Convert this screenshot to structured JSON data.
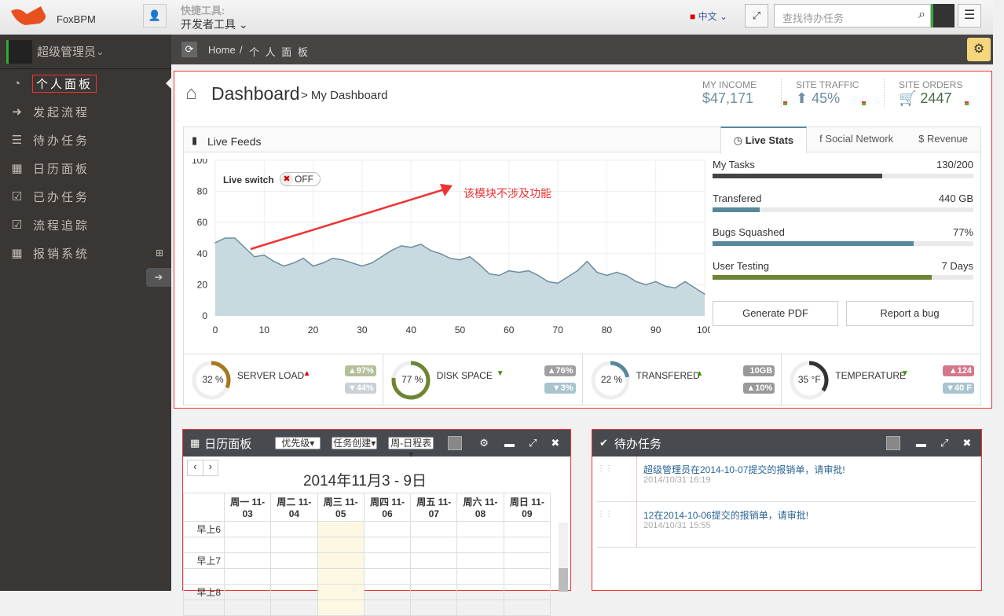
{
  "app": {
    "name": "FoxBPM",
    "quick_tools_label": "快捷工具:",
    "quick_tools_value": "开发者工具",
    "language": "中文",
    "search_placeholder": "查找待办任务"
  },
  "user": {
    "name": "超级管理员"
  },
  "sidebar": {
    "items": [
      {
        "label": "个人面板",
        "icon": "dashboard-icon",
        "active": true
      },
      {
        "label": "发起流程",
        "icon": "arrow-circle-right-icon"
      },
      {
        "label": "待办任务",
        "icon": "tasks-icon"
      },
      {
        "label": "日历面板",
        "icon": "calendar-icon"
      },
      {
        "label": "已办任务",
        "icon": "check-square-icon"
      },
      {
        "label": "流程追踪",
        "icon": "check-square-icon"
      },
      {
        "label": "报销系统",
        "icon": "calendar-icon",
        "expand": "⊞"
      }
    ]
  },
  "breadcrumb": {
    "home": "Home",
    "separator": "/",
    "current": "个 人 面 板"
  },
  "dashboard": {
    "title": "Dashboard",
    "subtitle": "> My Dashboard",
    "summary": [
      {
        "label": "MY INCOME",
        "value": "$47,171",
        "color": "#6c8ea0"
      },
      {
        "label": "SITE TRAFFIC",
        "value": "45%",
        "color": "#6c8ea0"
      },
      {
        "label": "SITE ORDERS",
        "value": "2447",
        "color": "#496949"
      }
    ],
    "feeds_title": "Live Feeds",
    "tabs": [
      {
        "label": "Live Stats",
        "active": true
      },
      {
        "label": "Social Network"
      },
      {
        "label": "Revenue"
      }
    ],
    "live_switch_label": "Live switch",
    "live_switch_state": "OFF",
    "annotation": "该模块不涉及功能",
    "stats": [
      {
        "label": "My Tasks",
        "value": "130/200",
        "percent": 65,
        "color": "#444"
      },
      {
        "label": "Transfered",
        "value": "440 GB",
        "percent": 18,
        "color": "#57889c"
      },
      {
        "label": "Bugs Squashed",
        "value": "77%",
        "percent": 77,
        "color": "#57889c"
      },
      {
        "label": "User Testing",
        "value": "7 Days",
        "percent": 84,
        "color": "#6e8534"
      }
    ],
    "generate_pdf": "Generate PDF",
    "report_bug": "Report a bug",
    "gauges": [
      {
        "value": "32 %",
        "percent": 32,
        "label": "SERVER LOAD",
        "color": "#a5771f",
        "trend": "up",
        "trend_color": "#e00",
        "b1": "▲97%",
        "b2": "▼44%",
        "c1": "#b5bf9a",
        "c2": "#c9d1d5"
      },
      {
        "value": "77 %",
        "percent": 77,
        "label": "DISK SPACE",
        "color": "#6e8534",
        "trend": "down",
        "trend_color": "#390",
        "b1": "▲76%",
        "b2": "▼3%",
        "c1": "#a0a0a0",
        "c2": "#a9c4cf"
      },
      {
        "value": "22 %",
        "percent": 22,
        "label": "TRANSFERED",
        "color": "#57889c",
        "trend": "up",
        "trend_color": "#390",
        "b1": "10GB",
        "b2": "▲10%",
        "c1": "#999",
        "c2": "#999"
      },
      {
        "value": "35 °F",
        "percent": 35,
        "label": "TEMPERATURE",
        "color": "#333",
        "trend": "down",
        "trend_color": "#390",
        "b1": "▲124",
        "b2": "▼40 F",
        "c1": "#d3788a",
        "c2": "#a9c4cf"
      }
    ]
  },
  "chart_data": {
    "type": "area",
    "xlim": [
      0,
      100
    ],
    "ylim": [
      0,
      100
    ],
    "xticks": [
      0,
      10,
      20,
      30,
      40,
      50,
      60,
      70,
      80,
      90,
      100
    ],
    "yticks": [
      0,
      20,
      40,
      60,
      80,
      100
    ],
    "grid": true,
    "x": [
      0,
      2,
      4,
      6,
      8,
      10,
      12,
      14,
      16,
      18,
      20,
      22,
      24,
      26,
      28,
      30,
      32,
      34,
      36,
      38,
      40,
      42,
      44,
      46,
      48,
      50,
      52,
      54,
      56,
      58,
      60,
      62,
      64,
      66,
      68,
      70,
      72,
      74,
      76,
      78,
      80,
      82,
      84,
      86,
      88,
      90,
      92,
      94,
      96,
      98,
      100
    ],
    "y": [
      47,
      50,
      50,
      44,
      38,
      39,
      35,
      32,
      34,
      37,
      32,
      34,
      37,
      36,
      34,
      32,
      34,
      38,
      42,
      45,
      44,
      46,
      42,
      40,
      37,
      36,
      38,
      33,
      27,
      26,
      29,
      28,
      29,
      26,
      22,
      21,
      25,
      29,
      35,
      28,
      26,
      28,
      26,
      22,
      20,
      22,
      19,
      18,
      22,
      18,
      14
    ]
  },
  "calendar": {
    "title": "日历面板",
    "filters": [
      "优先级",
      "任务创建",
      "周-日程表"
    ],
    "range": "2014年11月3 - 9日",
    "days": [
      "周一 11-03",
      "周二 11-04",
      "周三 11-05",
      "周四 11-06",
      "周五 11-07",
      "周六 11-08",
      "周日 11-09"
    ],
    "hours": [
      "早上6",
      "早上7",
      "早上8"
    ]
  },
  "todo": {
    "title": "待办任务",
    "items": [
      {
        "text": "超级管理员在2014-10-07提交的报销单，请审批!",
        "time": "2014/10/31 16:19"
      },
      {
        "text": "12在2014-10-06提交的报销单，请审批!",
        "time": "2014/10/31 15:55"
      }
    ]
  }
}
